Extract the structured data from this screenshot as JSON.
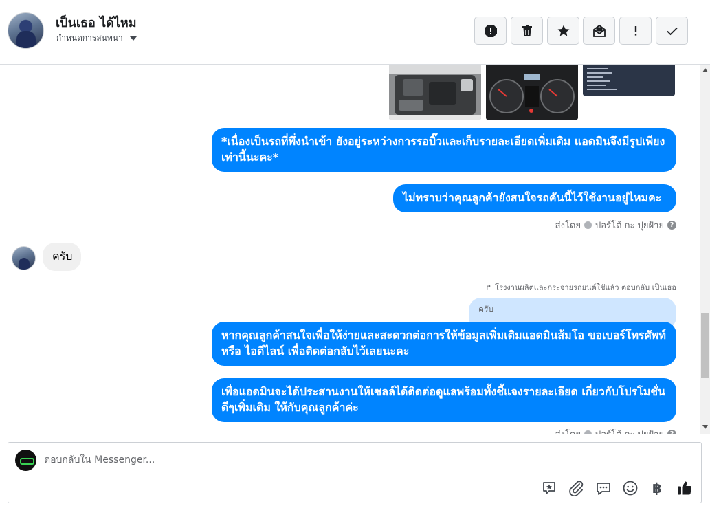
{
  "header": {
    "name": "เป็นเธอ ได้ไหม",
    "subtitle": "กำหนดการสนทนา",
    "actions": [
      "report-icon",
      "trash-icon",
      "star-icon",
      "mark-unread-icon",
      "exclamation-icon",
      "check-icon"
    ]
  },
  "messages": {
    "m1": "*เนื่องเป็นรถที่พึ่งนำเข้า ยังอยู่ระหว่างการรอบิ๊วและเก็บรายละเอียดเพิ่มเติม แอดมินจึงมีรูปเพียงเท่านี้นะคะ*",
    "m2": "ไม่ทราบว่าคุณลูกค้ายังสนใจรถคันนี้ไว้ใช้งานอยู่ไหมคะ",
    "sent_prefix": "ส่งโดย",
    "sent_by": "ปอร์โต้ กะ ปุยฝ้าย",
    "incoming": "ครับ",
    "reply_header": "โรงงานผลิตและกระจายรถยนต์ใช้แล้ว ตอบกลับ เป็นเธอ",
    "reply_quote": "ครับ",
    "m3": "หากคุณลูกค้าสนใจเพื่อให้ง่ายและสะดวกต่อการให้ข้อมูลเพิ่มเติมแอดมินส้มโอ ขอเบอร์โทรศัพท์ หรือ ไอดีไลน์ เพื่อติดต่อกลับไว้เลยนะคะ",
    "m4": "เพื่อแอดมินจะได้ประสานงานให้เซลล์ได้ติดต่อดูแลพร้อมทั้งชี้แจงรายละเอียด เกี่ยวกับโปรโมชั่นดีๆเพิ่มเติม ให้กับคุณลูกค้าค่ะ"
  },
  "composer": {
    "placeholder": "ตอบกลับใน Messenger...",
    "tools": [
      "sticker-icon",
      "attachment-icon",
      "saved-replies-icon",
      "emoji-icon",
      "baht-icon",
      "like-icon"
    ],
    "baht_symbol": "฿"
  },
  "colors": {
    "accent": "#0084ff",
    "incoming_bubble": "#f0f0f0",
    "quote_bubble": "#cfe6ff"
  }
}
